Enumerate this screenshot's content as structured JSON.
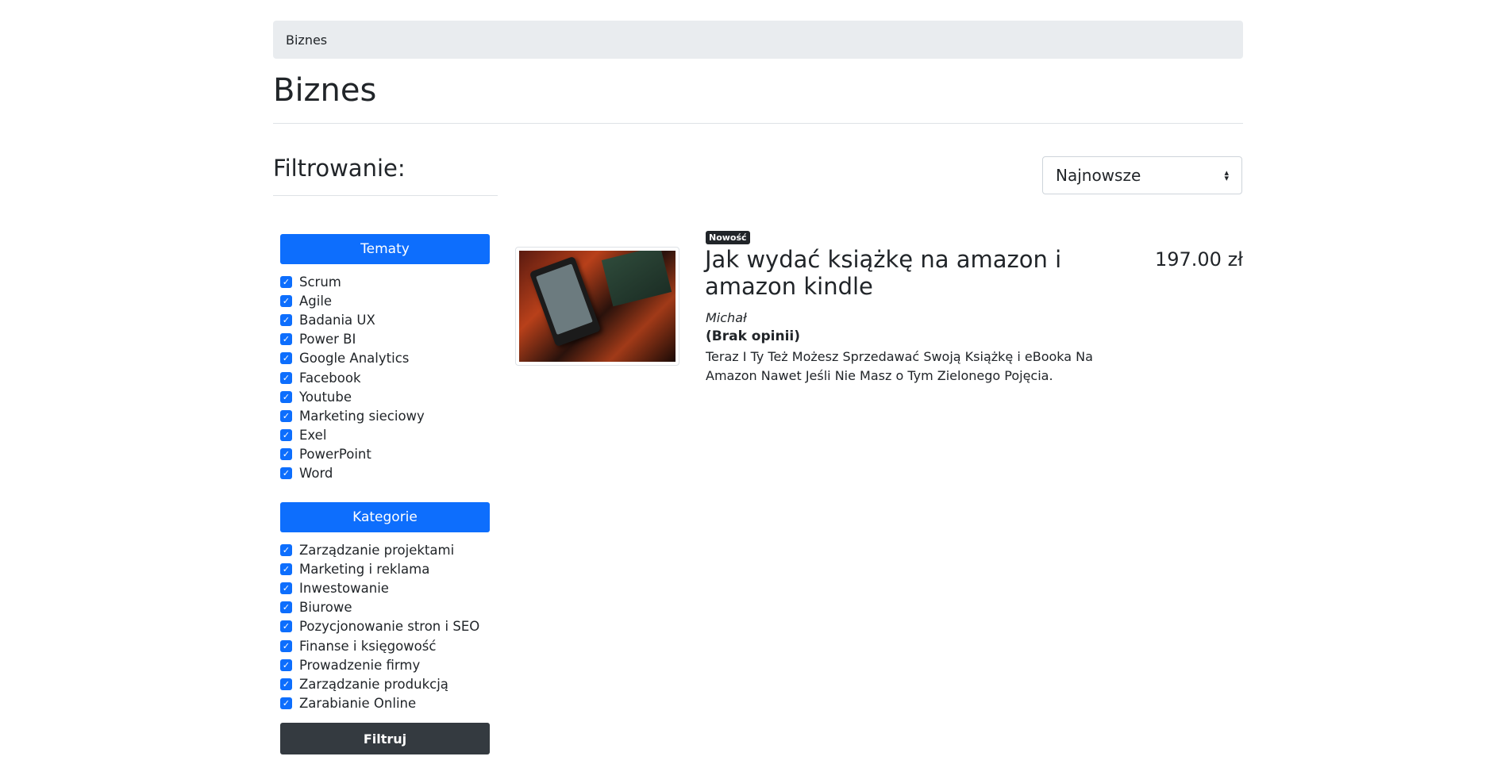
{
  "breadcrumb": {
    "current": "Biznes"
  },
  "page_title": "Biznes",
  "filters": {
    "heading": "Filtrowanie:",
    "topics": {
      "label": "Tematy",
      "items": [
        "Scrum",
        "Agile",
        "Badania UX",
        "Power BI",
        "Google Analytics",
        "Facebook",
        "Youtube",
        "Marketing sieciowy",
        "Exel",
        "PowerPoint",
        "Word"
      ]
    },
    "categories": {
      "label": "Kategorie",
      "items": [
        "Zarządzanie projektami",
        "Marketing i reklama",
        "Inwestowanie",
        "Biurowe",
        "Pozycjonowanie stron i SEO",
        "Finanse i księgowość",
        "Prowadzenie firmy",
        "Zarządzanie produkcją",
        "Zarabianie Online"
      ]
    },
    "submit_label": "Filtruj"
  },
  "sort": {
    "selected": "Najnowsze"
  },
  "product": {
    "badge": "Nowość",
    "title": "Jak wydać książkę na amazon i amazon kindle",
    "author": "Michał",
    "reviews": "(Brak opinii)",
    "description": "Teraz I Ty Też Możesz Sprzedawać Swoją Książkę i eBooka Na Amazon Nawet Jeśli Nie Masz o Tym Zielonego Pojęcia.",
    "price": "197.00 zł"
  },
  "colors": {
    "primary": "#0d6efd",
    "dark": "#343a40",
    "breadcrumb_bg": "#e9ecef"
  },
  "icons": {
    "checkbox": "check-icon",
    "select": "sort-arrows-icon"
  }
}
